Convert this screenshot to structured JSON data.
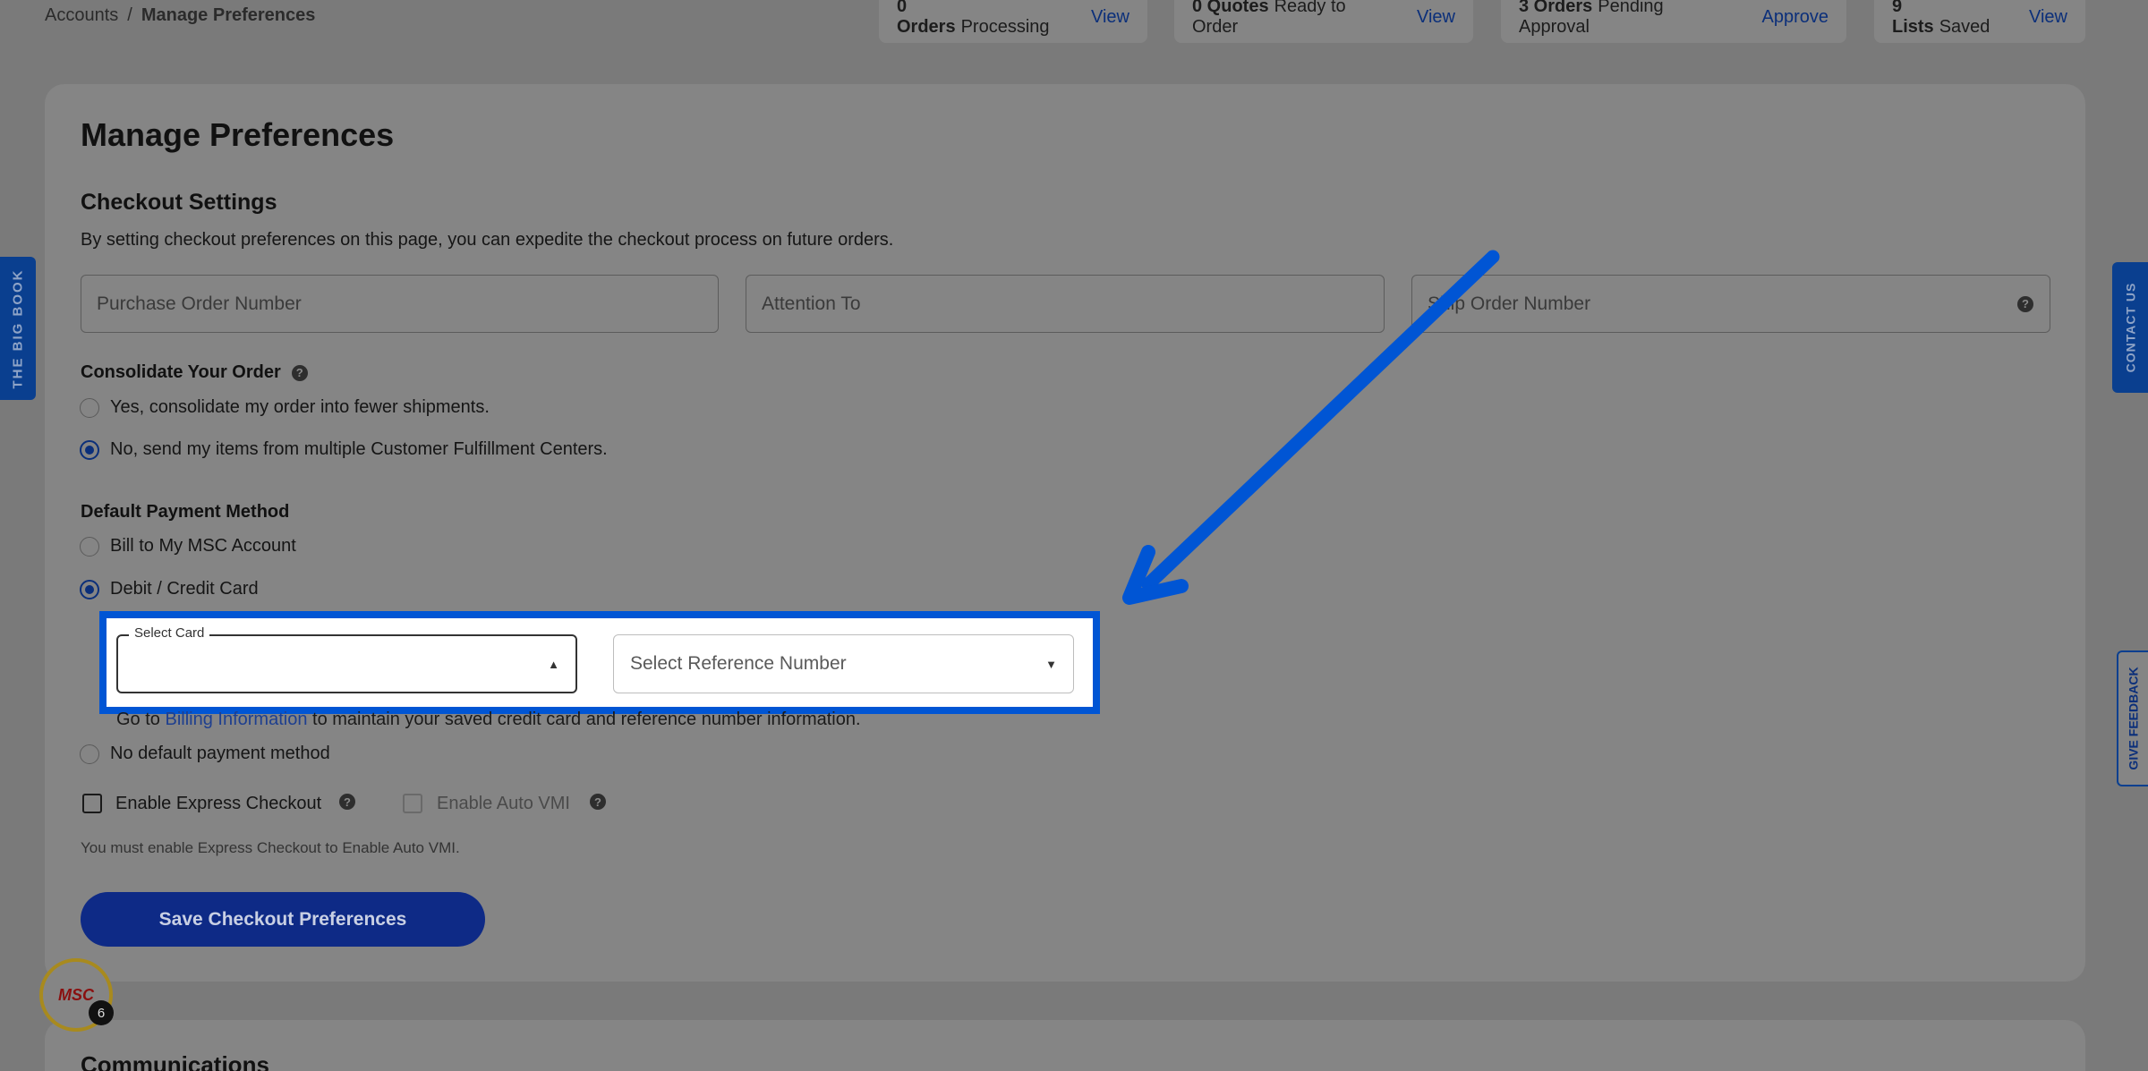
{
  "breadcrumb": {
    "root": "Accounts",
    "separator": "/",
    "current": "Manage Preferences"
  },
  "stats": [
    {
      "count": "0 Orders",
      "label": "Processing",
      "action": "View"
    },
    {
      "count": "0 Quotes",
      "label": "Ready to Order",
      "action": "View"
    },
    {
      "count": "3 Orders",
      "label": "Pending Approval",
      "action": "Approve"
    },
    {
      "count": "9 Lists",
      "label": "Saved",
      "action": "View"
    }
  ],
  "page_title": "Manage Preferences",
  "checkout": {
    "heading": "Checkout Settings",
    "description": "By setting checkout preferences on this page, you can expedite the checkout process on future orders.",
    "po_placeholder": "Purchase Order Number",
    "attention_placeholder": "Attention To",
    "ship_order_placeholder": "Ship Order Number"
  },
  "consolidate": {
    "label": "Consolidate Your Order",
    "options": [
      {
        "label": "Yes, consolidate my order into fewer shipments.",
        "selected": false
      },
      {
        "label": "No, send my items from multiple Customer Fulfillment Centers.",
        "selected": true
      }
    ]
  },
  "payment": {
    "label": "Default Payment Method",
    "options": [
      {
        "label": "Bill to My MSC Account",
        "selected": false
      },
      {
        "label": "Debit / Credit Card",
        "selected": true
      },
      {
        "label": "No default payment method",
        "selected": false
      }
    ],
    "select_card_label": "Select Card",
    "select_reference_placeholder": "Select Reference Number",
    "note_prefix": "Go to",
    "note_link": "Billing Information",
    "note_suffix": "to maintain your saved credit card and reference number information."
  },
  "express": {
    "express_label": "Enable Express Checkout",
    "auto_vmi_label": "Enable Auto VMI",
    "hint": "You must enable Express Checkout to Enable Auto VMI."
  },
  "save_button": "Save Checkout Preferences",
  "communications_heading": "Communications",
  "side_tabs": {
    "left": "THE BIG BOOK",
    "contact": "CONTACT US",
    "feedback": "GIVE FEEDBACK"
  },
  "msc_badge": {
    "logo": "MSC",
    "count": "6"
  },
  "help_glyph": "?",
  "caret_up": "▲",
  "caret_down": "▼",
  "colors": {
    "highlight": "#0055d4",
    "primary": "#0e2a86",
    "overlay": "#7a7a7a"
  }
}
